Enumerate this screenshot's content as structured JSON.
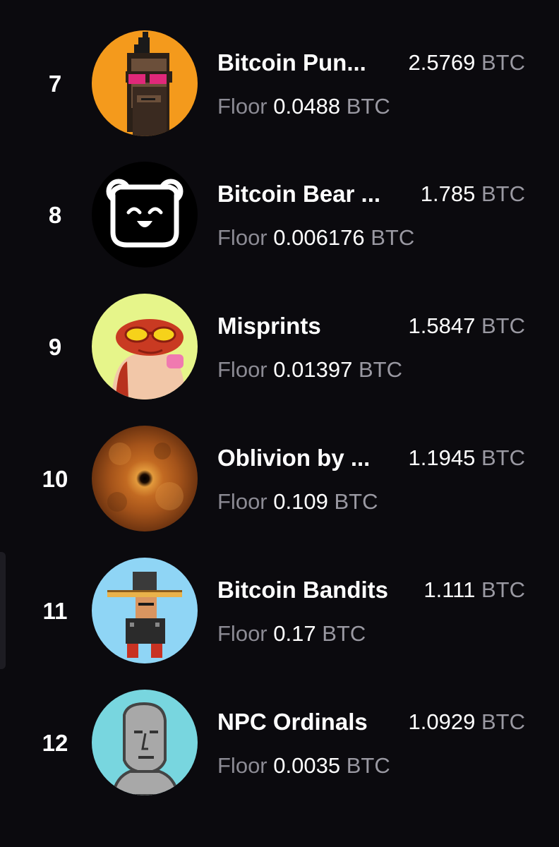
{
  "collections": [
    {
      "rank": "7",
      "name": "Bitcoin Pun...",
      "volume": "2.5769",
      "volume_unit": "BTC",
      "floor_label": "Floor",
      "floor": "0.0488",
      "floor_unit": "BTC",
      "avatar_bg": "#f49a1c",
      "icon": "bitcoin-punk-avatar"
    },
    {
      "rank": "8",
      "name": "Bitcoin Bear ...",
      "volume": "1.785",
      "volume_unit": "BTC",
      "floor_label": "Floor",
      "floor": "0.006176",
      "floor_unit": "BTC",
      "avatar_bg": "#000000",
      "icon": "bitcoin-bear-avatar"
    },
    {
      "rank": "9",
      "name": "Misprints",
      "volume": "1.5847",
      "volume_unit": "BTC",
      "floor_label": "Floor",
      "floor": "0.01397",
      "floor_unit": "BTC",
      "avatar_bg": "#e6f58a",
      "icon": "misprints-frog-avatar"
    },
    {
      "rank": "10",
      "name": "Oblivion by ...",
      "volume": "1.1945",
      "volume_unit": "BTC",
      "floor_label": "Floor",
      "floor": "0.109",
      "floor_unit": "BTC",
      "avatar_bg": "#b8601e",
      "icon": "oblivion-blackhole-avatar"
    },
    {
      "rank": "11",
      "name": "Bitcoin Bandits",
      "volume": "1.111",
      "volume_unit": "BTC",
      "floor_label": "Floor",
      "floor": "0.17",
      "floor_unit": "BTC",
      "avatar_bg": "#8fd5f5",
      "icon": "bitcoin-bandit-avatar"
    },
    {
      "rank": "12",
      "name": "NPC Ordinals",
      "volume": "1.0929",
      "volume_unit": "BTC",
      "floor_label": "Floor",
      "floor": "0.0035",
      "floor_unit": "BTC",
      "avatar_bg": "#78d6df",
      "icon": "npc-face-avatar"
    }
  ]
}
